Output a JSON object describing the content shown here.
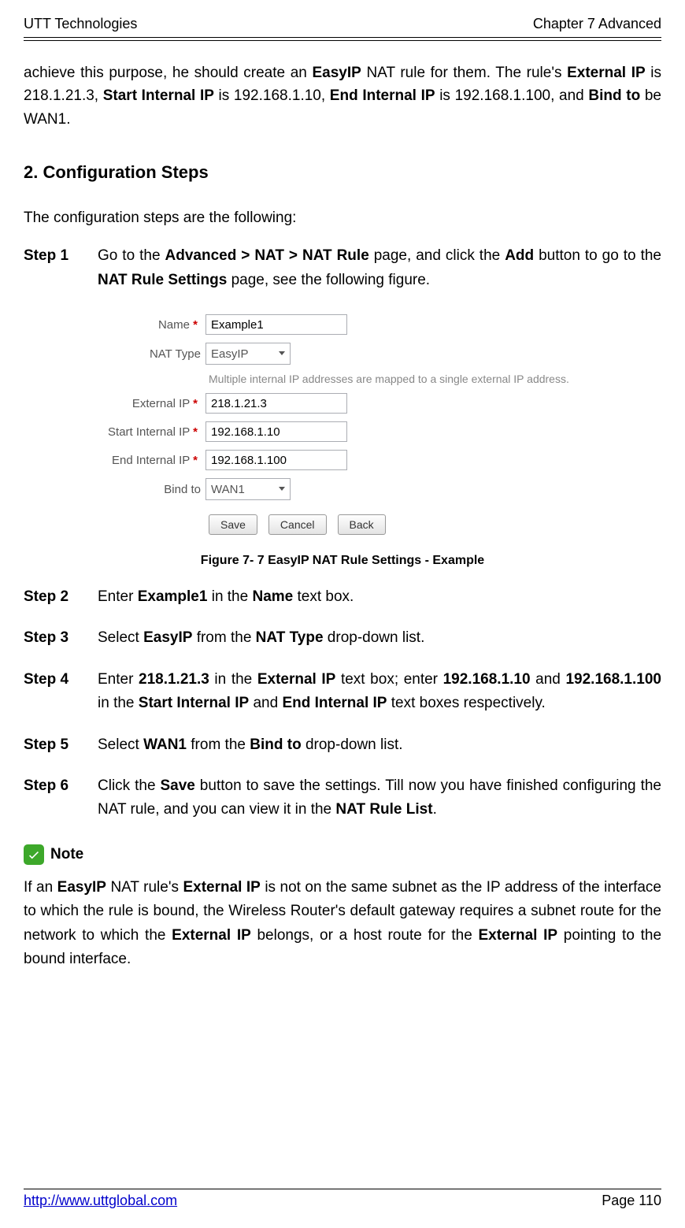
{
  "header": {
    "left": "UTT Technologies",
    "right": "Chapter 7 Advanced"
  },
  "intro": {
    "pre": "achieve this purpose, he should create an ",
    "w1": "EasyIP",
    "mid1": " NAT rule for them. The rule's ",
    "w2": "External IP",
    "mid2": " is 218.1.21.3, ",
    "w3": "Start Internal IP",
    "mid3": " is 192.168.1.10, ",
    "w4": "End Internal IP",
    "mid4": " is 192.168.1.100, and ",
    "w5": "Bind to",
    "tail": " be WAN1."
  },
  "section": "2.   Configuration Steps",
  "lead": "The configuration steps are the following:",
  "steps": {
    "s1": {
      "label": "Step 1",
      "a": "Go to the ",
      "b1": "Advanced > NAT > NAT Rule",
      "c": " page, and click the ",
      "b2": "Add",
      "d": " button to go to the ",
      "b3": "NAT Rule Settings",
      "e": " page, see the following figure."
    },
    "s2": {
      "label": "Step 2",
      "a": "Enter ",
      "b1": "Example1",
      "c": " in the ",
      "b2": "Name",
      "d": " text box."
    },
    "s3": {
      "label": "Step 3",
      "a": "Select ",
      "b1": "EasyIP",
      "c": " from the ",
      "b2": "NAT Type",
      "d": " drop-down list."
    },
    "s4": {
      "label": "Step 4",
      "a": "Enter ",
      "b1": "218.1.21.3",
      "c": " in the ",
      "b2": "External IP",
      "d": " text box; enter ",
      "b3": "192.168.1.10",
      "e": " and ",
      "b4": "192.168.1.100",
      "f": " in the ",
      "b5": "Start Internal IP",
      "g": " and ",
      "b6": "End Internal IP",
      "h": " text boxes respectively."
    },
    "s5": {
      "label": "Step 5",
      "a": "Select ",
      "b1": "WAN1",
      "c": " from the ",
      "b2": "Bind to",
      "d": " drop-down list."
    },
    "s6": {
      "label": "Step 6",
      "a": "Click the ",
      "b1": "Save",
      "c": " button to save the settings. Till now you have finished configuring the NAT rule, and you can view it in the ",
      "b2": "NAT Rule List",
      "d": "."
    }
  },
  "form": {
    "labels": {
      "name": "Name",
      "nat_type": "NAT Type",
      "external_ip": "External IP",
      "start_internal": "Start Internal IP",
      "end_internal": "End Internal IP",
      "bind_to": "Bind to"
    },
    "values": {
      "name": "Example1",
      "nat_type": "EasyIP",
      "external_ip": "218.1.21.3",
      "start_internal": "192.168.1.10",
      "end_internal": "192.168.1.100",
      "bind_to": "WAN1"
    },
    "hint": "Multiple internal IP addresses are mapped to a single external IP address.",
    "buttons": {
      "save": "Save",
      "cancel": "Cancel",
      "back": "Back"
    },
    "req": "*"
  },
  "caption": "Figure 7- 7 EasyIP NAT Rule Settings - Example",
  "note": {
    "label": "Note",
    "a": "If an ",
    "b1": "EasyIP",
    "c": " NAT rule's ",
    "b2": "External IP",
    "d": " is not on the same subnet as the IP address of the interface to which the rule is bound, the Wireless Router's default gateway requires a subnet route for the network to which the ",
    "b3": "External IP",
    "e": " belongs, or a host route for the ",
    "b4": "External IP",
    "f": " pointing to the bound interface."
  },
  "footer": {
    "url": "http://www.uttglobal.com",
    "page": "Page 110"
  }
}
